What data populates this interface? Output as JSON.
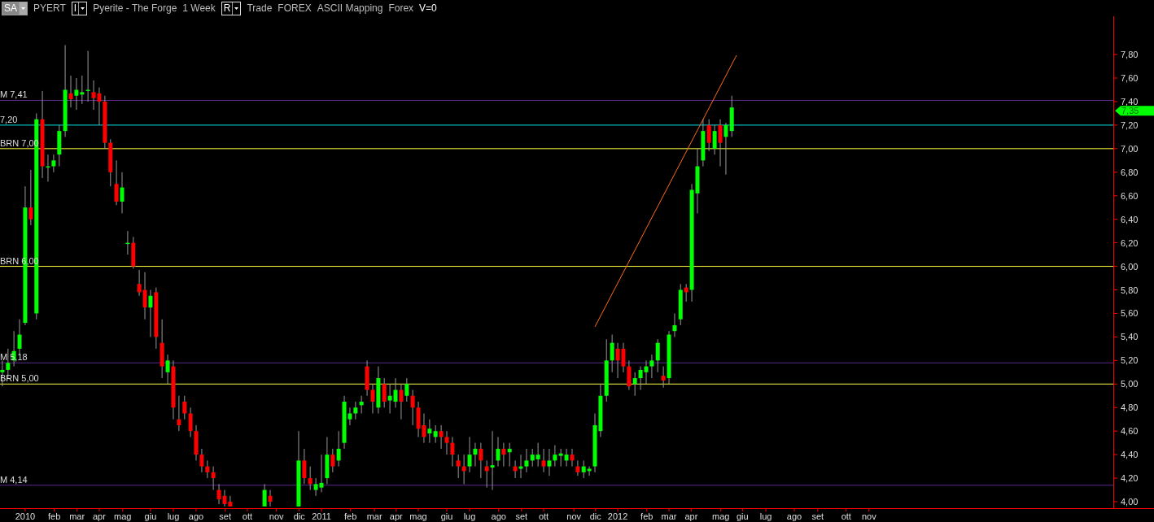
{
  "header": {
    "items": [
      {
        "kind": "dropdown",
        "text": "SA"
      },
      {
        "kind": "label",
        "text": "PYERT"
      },
      {
        "kind": "dropdown",
        "text": "I"
      },
      {
        "kind": "label",
        "text": "Pyerite - The Forge"
      },
      {
        "kind": "label",
        "text": "1 Week"
      },
      {
        "kind": "dropdown",
        "text": "R"
      },
      {
        "kind": "label",
        "text": "Trade"
      },
      {
        "kind": "label",
        "text": "FOREX"
      },
      {
        "kind": "label",
        "text": "ASCII Mapping"
      },
      {
        "kind": "label",
        "text": "Forex"
      },
      {
        "kind": "value",
        "text": "V=0"
      }
    ]
  },
  "price_tag": {
    "label": "7,35",
    "color": "#00ff00"
  },
  "chart_data": {
    "type": "candlestick",
    "xlim": [
      2009.915,
      2013.81
    ],
    "ylim": [
      3.945,
      8.125
    ],
    "yticks": [
      {
        "value": 4,
        "label": "4,00"
      },
      {
        "value": 4.2,
        "label": "4,20"
      },
      {
        "value": 4.4,
        "label": "4,40"
      },
      {
        "value": 4.6,
        "label": "4,60"
      },
      {
        "value": 4.8,
        "label": "4,80"
      },
      {
        "value": 5,
        "label": "5,00"
      },
      {
        "value": 5.2,
        "label": "5,20"
      },
      {
        "value": 5.4,
        "label": "5,40"
      },
      {
        "value": 5.6,
        "label": "5,60"
      },
      {
        "value": 5.8,
        "label": "5,80"
      },
      {
        "value": 6,
        "label": "6,00"
      },
      {
        "value": 6.2,
        "label": "6,20"
      },
      {
        "value": 6.4,
        "label": "6,40"
      },
      {
        "value": 6.6,
        "label": "6,60"
      },
      {
        "value": 6.8,
        "label": "6,80"
      },
      {
        "value": 7,
        "label": "7,00"
      },
      {
        "value": 7.2,
        "label": "7,20"
      },
      {
        "value": 7.4,
        "label": "7,40"
      },
      {
        "value": 7.6,
        "label": "7,60"
      },
      {
        "value": 7.8,
        "label": "7,80"
      }
    ],
    "xticks": [
      {
        "value": 2010,
        "label": "2010"
      },
      {
        "value": 2010.098,
        "label": "feb"
      },
      {
        "value": 2010.175,
        "label": "mar"
      },
      {
        "value": 2010.25,
        "label": "apr"
      },
      {
        "value": 2010.329,
        "label": "mag"
      },
      {
        "value": 2010.423,
        "label": "giu"
      },
      {
        "value": 2010.5,
        "label": "lug"
      },
      {
        "value": 2010.577,
        "label": "ago"
      },
      {
        "value": 2010.675,
        "label": "set"
      },
      {
        "value": 2010.75,
        "label": "ott"
      },
      {
        "value": 2010.848,
        "label": "nov"
      },
      {
        "value": 2010.925,
        "label": "dic"
      },
      {
        "value": 2011,
        "label": "2011"
      },
      {
        "value": 2011.098,
        "label": "feb"
      },
      {
        "value": 2011.179,
        "label": "mar"
      },
      {
        "value": 2011.252,
        "label": "apr"
      },
      {
        "value": 2011.327,
        "label": "mag"
      },
      {
        "value": 2011.423,
        "label": "giu"
      },
      {
        "value": 2011.5,
        "label": "lug"
      },
      {
        "value": 2011.598,
        "label": "ago"
      },
      {
        "value": 2011.675,
        "label": "set"
      },
      {
        "value": 2011.75,
        "label": "ott"
      },
      {
        "value": 2011.852,
        "label": "nov"
      },
      {
        "value": 2011.925,
        "label": "dic"
      },
      {
        "value": 2012,
        "label": "2012"
      },
      {
        "value": 2012.098,
        "label": "feb"
      },
      {
        "value": 2012.173,
        "label": "mar"
      },
      {
        "value": 2012.248,
        "label": "apr"
      },
      {
        "value": 2012.348,
        "label": "mag"
      },
      {
        "value": 2012.421,
        "label": "giu"
      },
      {
        "value": 2012.5,
        "label": "lug"
      },
      {
        "value": 2012.596,
        "label": "ago"
      },
      {
        "value": 2012.675,
        "label": "set"
      },
      {
        "value": 2012.771,
        "label": "ott"
      },
      {
        "value": 2012.848,
        "label": "nov"
      }
    ],
    "x": [
      2009.923,
      2009.942,
      2009.962,
      2009.981,
      2010,
      2010.019,
      2010.038,
      2010.058,
      2010.077,
      2010.096,
      2010.115,
      2010.135,
      2010.154,
      2010.173,
      2010.192,
      2010.212,
      2010.231,
      2010.25,
      2010.269,
      2010.288,
      2010.308,
      2010.327,
      2010.346,
      2010.365,
      2010.385,
      2010.404,
      2010.423,
      2010.442,
      2010.462,
      2010.481,
      2010.5,
      2010.519,
      2010.538,
      2010.558,
      2010.577,
      2010.596,
      2010.615,
      2010.635,
      2010.654,
      2010.673,
      2010.692,
      2010.808,
      2010.827,
      2010.923,
      2010.942,
      2010.962,
      2010.981,
      2011,
      2011.019,
      2011.038,
      2011.058,
      2011.077,
      2011.096,
      2011.115,
      2011.135,
      2011.154,
      2011.173,
      2011.192,
      2011.212,
      2011.231,
      2011.25,
      2011.269,
      2011.288,
      2011.308,
      2011.327,
      2011.346,
      2011.365,
      2011.385,
      2011.404,
      2011.423,
      2011.442,
      2011.462,
      2011.481,
      2011.5,
      2011.519,
      2011.538,
      2011.558,
      2011.577,
      2011.596,
      2011.615,
      2011.635,
      2011.654,
      2011.673,
      2011.692,
      2011.712,
      2011.731,
      2011.75,
      2011.769,
      2011.788,
      2011.808,
      2011.827,
      2011.846,
      2011.865,
      2011.885,
      2011.904,
      2011.923,
      2011.942,
      2011.962,
      2011.981,
      2012,
      2012.019,
      2012.038,
      2012.058,
      2012.077,
      2012.096,
      2012.115,
      2012.135,
      2012.154,
      2012.173,
      2012.192,
      2012.212,
      2012.231,
      2012.25,
      2012.269,
      2012.288,
      2012.308,
      2012.327,
      2012.346,
      2012.365,
      2012.385
    ],
    "ohlc": [
      [
        5.1,
        5.2,
        4.98,
        5.12
      ],
      [
        5.12,
        5.3,
        5.05,
        5.18
      ],
      [
        5.2,
        5.45,
        5.15,
        5.28
      ],
      [
        5.3,
        5.55,
        5.25,
        5.42
      ],
      [
        5.52,
        6.68,
        5.5,
        6.5
      ],
      [
        6.5,
        6.82,
        6.35,
        6.4
      ],
      [
        5.6,
        7.3,
        5.55,
        7.25
      ],
      [
        7.25,
        7.49,
        6.75,
        6.85
      ],
      [
        6.85,
        6.95,
        6.72,
        6.85
      ],
      [
        6.85,
        6.95,
        6.8,
        6.9
      ],
      [
        6.95,
        7.2,
        6.85,
        7.15
      ],
      [
        7.15,
        7.88,
        7.1,
        7.5
      ],
      [
        7.47,
        7.62,
        7.35,
        7.42
      ],
      [
        7.45,
        7.6,
        7.33,
        7.5
      ],
      [
        7.46,
        7.62,
        7.38,
        7.48
      ],
      [
        7.49,
        7.83,
        7.4,
        7.5
      ],
      [
        7.48,
        7.58,
        7.33,
        7.43
      ],
      [
        7.47,
        7.52,
        7.2,
        7.4
      ],
      [
        7.4,
        7.45,
        7.0,
        7.05
      ],
      [
        7.05,
        7.08,
        6.68,
        6.8
      ],
      [
        6.7,
        6.9,
        6.52,
        6.55
      ],
      [
        6.55,
        6.8,
        6.45,
        6.67
      ],
      [
        6.2,
        6.3,
        6.1,
        6.2
      ],
      [
        6.2,
        6.25,
        5.98,
        6.0
      ],
      [
        5.85,
        5.97,
        5.75,
        5.78
      ],
      [
        5.8,
        5.95,
        5.55,
        5.65
      ],
      [
        5.65,
        5.8,
        5.4,
        5.75
      ],
      [
        5.78,
        5.82,
        5.3,
        5.4
      ],
      [
        5.35,
        5.55,
        5.05,
        5.15
      ],
      [
        5.1,
        5.25,
        5.0,
        5.2
      ],
      [
        5.15,
        5.2,
        4.7,
        4.8
      ],
      [
        4.7,
        4.9,
        4.6,
        4.65
      ],
      [
        4.85,
        4.9,
        4.7,
        4.75
      ],
      [
        4.75,
        4.8,
        4.55,
        4.6
      ],
      [
        4.6,
        4.65,
        4.35,
        4.4
      ],
      [
        4.4,
        4.45,
        4.25,
        4.3
      ],
      [
        4.3,
        4.35,
        4.2,
        4.25
      ],
      [
        4.25,
        4.3,
        4.1,
        4.2
      ],
      [
        4.1,
        4.15,
        3.98,
        4.02
      ],
      [
        4.05,
        4.1,
        3.96,
        3.98
      ],
      [
        4.0,
        4.05,
        3.96,
        3.96
      ],
      [
        3.96,
        4.15,
        3.96,
        4.1
      ],
      [
        4.05,
        4.1,
        3.96,
        4.0
      ],
      [
        3.96,
        4.6,
        3.96,
        4.35
      ],
      [
        4.35,
        4.45,
        4.15,
        4.2
      ],
      [
        4.2,
        4.3,
        4.1,
        4.15
      ],
      [
        4.1,
        4.2,
        4.05,
        4.15
      ],
      [
        4.12,
        4.4,
        4.08,
        4.16
      ],
      [
        4.2,
        4.55,
        4.15,
        4.4
      ],
      [
        4.4,
        4.45,
        4.25,
        4.3
      ],
      [
        4.35,
        4.6,
        4.3,
        4.45
      ],
      [
        4.5,
        4.9,
        4.45,
        4.85
      ],
      [
        4.7,
        4.8,
        4.65,
        4.75
      ],
      [
        4.75,
        4.85,
        4.7,
        4.8
      ],
      [
        4.82,
        4.9,
        4.75,
        4.85
      ],
      [
        5.15,
        5.2,
        4.9,
        4.95
      ],
      [
        4.95,
        5.0,
        4.75,
        4.85
      ],
      [
        4.8,
        5.15,
        4.75,
        5.05
      ],
      [
        5.0,
        5.05,
        4.8,
        4.85
      ],
      [
        4.86,
        5.0,
        4.75,
        4.9
      ],
      [
        4.85,
        5.05,
        4.8,
        4.95
      ],
      [
        4.95,
        5.0,
        4.7,
        4.85
      ],
      [
        4.9,
        5.05,
        4.85,
        5.0
      ],
      [
        4.9,
        4.95,
        4.65,
        4.8
      ],
      [
        4.8,
        4.85,
        4.55,
        4.62
      ],
      [
        4.65,
        4.75,
        4.5,
        4.55
      ],
      [
        4.58,
        4.7,
        4.5,
        4.62
      ],
      [
        4.55,
        4.65,
        4.5,
        4.6
      ],
      [
        4.6,
        4.65,
        4.45,
        4.55
      ],
      [
        4.55,
        4.6,
        4.4,
        4.5
      ],
      [
        4.5,
        4.55,
        4.3,
        4.4
      ],
      [
        4.35,
        4.4,
        4.2,
        4.3
      ],
      [
        4.3,
        4.4,
        4.15,
        4.26
      ],
      [
        4.3,
        4.55,
        4.25,
        4.4
      ],
      [
        4.4,
        4.5,
        4.3,
        4.45
      ],
      [
        4.45,
        4.5,
        4.2,
        4.35
      ],
      [
        4.3,
        4.35,
        4.12,
        4.26
      ],
      [
        4.29,
        4.6,
        4.1,
        4.31
      ],
      [
        4.35,
        4.55,
        4.3,
        4.45
      ],
      [
        4.45,
        4.5,
        4.3,
        4.4
      ],
      [
        4.42,
        4.5,
        4.3,
        4.45
      ],
      [
        4.3,
        4.35,
        4.2,
        4.26
      ],
      [
        4.28,
        4.4,
        4.2,
        4.3
      ],
      [
        4.3,
        4.45,
        4.25,
        4.35
      ],
      [
        4.35,
        4.45,
        4.3,
        4.4
      ],
      [
        4.36,
        4.5,
        4.3,
        4.4
      ],
      [
        4.35,
        4.45,
        4.25,
        4.3
      ],
      [
        4.3,
        4.45,
        4.22,
        4.35
      ],
      [
        4.35,
        4.48,
        4.3,
        4.4
      ],
      [
        4.39,
        4.45,
        4.3,
        4.41
      ],
      [
        4.35,
        4.45,
        4.3,
        4.4
      ],
      [
        4.4,
        4.45,
        4.3,
        4.35
      ],
      [
        4.3,
        4.35,
        4.22,
        4.25
      ],
      [
        4.25,
        4.35,
        4.2,
        4.3
      ],
      [
        4.26,
        4.3,
        4.22,
        4.28
      ],
      [
        4.3,
        4.75,
        4.25,
        4.65
      ],
      [
        4.6,
        5.0,
        4.55,
        4.9
      ],
      [
        4.9,
        5.38,
        4.85,
        5.2
      ],
      [
        5.2,
        5.42,
        5.1,
        5.35
      ],
      [
        5.3,
        5.35,
        5.05,
        5.2
      ],
      [
        5.3,
        5.35,
        5.1,
        5.15
      ],
      [
        5.15,
        5.2,
        4.95,
        4.98
      ],
      [
        5.0,
        5.1,
        4.9,
        5.05
      ],
      [
        5.05,
        5.15,
        4.95,
        5.12
      ],
      [
        5.1,
        5.2,
        5.0,
        5.15
      ],
      [
        5.15,
        5.25,
        5.05,
        5.2
      ],
      [
        5.2,
        5.38,
        5.1,
        5.35
      ],
      [
        5.07,
        5.15,
        4.97,
        5.03
      ],
      [
        5.05,
        5.45,
        5.0,
        5.42
      ],
      [
        5.45,
        5.6,
        5.4,
        5.5
      ],
      [
        5.55,
        5.85,
        5.5,
        5.8
      ],
      [
        5.82,
        5.85,
        5.7,
        5.78
      ],
      [
        5.8,
        6.7,
        5.7,
        6.65
      ],
      [
        6.62,
        7.0,
        6.45,
        6.85
      ],
      [
        6.9,
        7.25,
        6.85,
        7.15
      ],
      [
        7.2,
        7.25,
        6.98,
        7.05
      ],
      [
        7.0,
        7.2,
        6.95,
        7.15
      ],
      [
        7.2,
        7.25,
        6.85,
        7.05
      ],
      [
        7.1,
        7.22,
        6.78,
        7.2
      ],
      [
        7.15,
        7.45,
        7.1,
        7.35
      ]
    ],
    "ref_lines": [
      {
        "axis": "y",
        "value": 7.41,
        "label": "M 7,41",
        "color": "#5a2a8a"
      },
      {
        "axis": "y",
        "value": 7.2,
        "label": "7,20",
        "color": "#00e5e5"
      },
      {
        "axis": "y",
        "value": 7.0,
        "label": "BRN 7,00",
        "color": "#ffff40"
      },
      {
        "axis": "y",
        "value": 6.0,
        "label": "BRN 6,00",
        "color": "#ffff40"
      },
      {
        "axis": "y",
        "value": 5.18,
        "label": "M 5,18",
        "color": "#5a2a8a"
      },
      {
        "axis": "y",
        "value": 5.0,
        "label": "BRN 5,00",
        "color": "#ffff40"
      },
      {
        "axis": "y",
        "value": 4.14,
        "label": "M 4,14",
        "color": "#5a2a8a"
      }
    ]
  }
}
